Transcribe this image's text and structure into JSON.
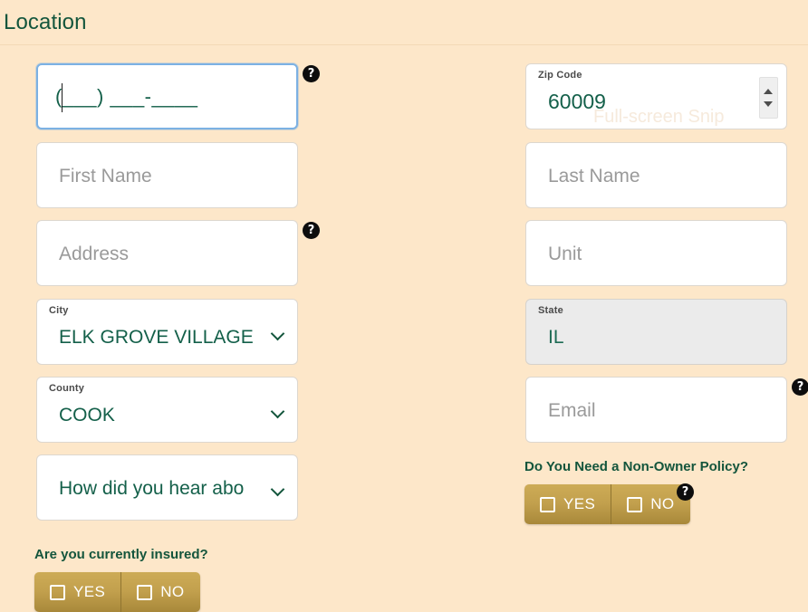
{
  "section": {
    "title": "Location"
  },
  "watermark": {
    "text": "Full-screen Snip"
  },
  "colors": {
    "page_background": "#fde7c9",
    "heading_green": "#13553c",
    "value_green": "#14604a",
    "placeholder_gray": "#9a9a9a",
    "focus_blue": "#7cb1e3",
    "button_gold_top": "#cdab56",
    "button_gold_bottom": "#a8883a",
    "disabled_gray": "#ebebeb",
    "help_badge": "#0d0d0d"
  },
  "help_icon": {
    "glyph": "?",
    "name": "help-icon"
  },
  "fields": {
    "phone": {
      "label": "",
      "mask": "(___) ___-____",
      "value": "",
      "focused": true,
      "has_help": true
    },
    "zip": {
      "label": "Zip Code",
      "value": "60009",
      "has_spinner": true,
      "spinner_up": "increment-zip",
      "spinner_down": "decrement-zip"
    },
    "first_name": {
      "label": "",
      "placeholder": "First Name",
      "value": ""
    },
    "last_name": {
      "label": "",
      "placeholder": "Last Name",
      "value": ""
    },
    "address": {
      "label": "",
      "placeholder": "Address",
      "value": "",
      "has_help": true
    },
    "unit": {
      "label": "",
      "placeholder": "Unit",
      "value": ""
    },
    "city": {
      "label": "City",
      "value": "ELK GROVE VILLAGE",
      "is_select": true
    },
    "state": {
      "label": "State",
      "value": "IL",
      "disabled": true
    },
    "county": {
      "label": "County",
      "value": "COOK",
      "is_select": true
    },
    "email": {
      "label": "",
      "placeholder": "Email",
      "value": "",
      "has_help": true
    },
    "referral": {
      "label": "",
      "value": "How did you hear abo",
      "is_select": true
    }
  },
  "questions": {
    "non_owner": {
      "text": "Do You Need a Non-Owner Policy?",
      "yes_label": "YES",
      "no_label": "NO",
      "has_help": true
    },
    "currently_insured": {
      "text": "Are you currently insured?",
      "yes_label": "YES",
      "no_label": "NO"
    }
  }
}
